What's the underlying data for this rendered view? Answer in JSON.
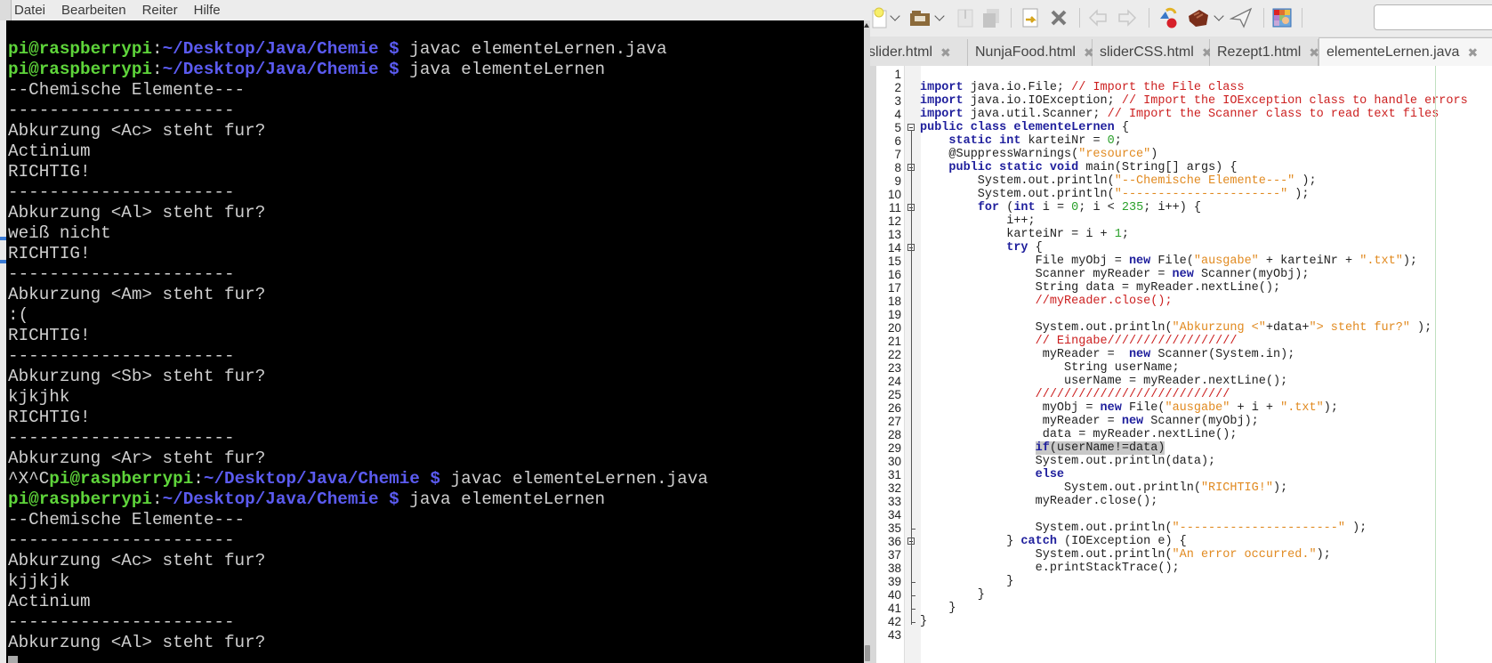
{
  "terminal": {
    "menu": [
      "Datei",
      "Bearbeiten",
      "Reiter",
      "Hilfe"
    ],
    "prompt_user": "pi@raspberrypi",
    "prompt_path": "~/Desktop/Java/Chemie $",
    "lines": [
      {
        "kind": "prompt",
        "prefix": "",
        "cmd": " javac elementeLernen.java"
      },
      {
        "kind": "prompt",
        "prefix": "",
        "cmd": " java elementeLernen"
      },
      {
        "kind": "text",
        "text": "--Chemische Elemente---"
      },
      {
        "kind": "text",
        "text": "----------------------"
      },
      {
        "kind": "text",
        "text": "Abkurzung <Ac> steht fur?"
      },
      {
        "kind": "text",
        "text": "Actinium"
      },
      {
        "kind": "text",
        "text": "RICHTIG!"
      },
      {
        "kind": "text",
        "text": "----------------------"
      },
      {
        "kind": "text",
        "text": "Abkurzung <Al> steht fur?"
      },
      {
        "kind": "text",
        "text": "weiß nicht"
      },
      {
        "kind": "text",
        "text": "RICHTIG!"
      },
      {
        "kind": "text",
        "text": "----------------------"
      },
      {
        "kind": "text",
        "text": "Abkurzung <Am> steht fur?"
      },
      {
        "kind": "text",
        "text": ":("
      },
      {
        "kind": "text",
        "text": "RICHTIG!"
      },
      {
        "kind": "text",
        "text": "----------------------"
      },
      {
        "kind": "text",
        "text": "Abkurzung <Sb> steht fur?"
      },
      {
        "kind": "text",
        "text": "kjkjhk"
      },
      {
        "kind": "text",
        "text": "RICHTIG!"
      },
      {
        "kind": "text",
        "text": "----------------------"
      },
      {
        "kind": "text",
        "text": "Abkurzung <Ar> steht fur?"
      },
      {
        "kind": "prompt",
        "prefix": "^X^C",
        "cmd": " javac elementeLernen.java"
      },
      {
        "kind": "prompt",
        "prefix": "",
        "cmd": " java elementeLernen"
      },
      {
        "kind": "text",
        "text": "--Chemische Elemente---"
      },
      {
        "kind": "text",
        "text": "----------------------"
      },
      {
        "kind": "text",
        "text": "Abkurzung <Ac> steht fur?"
      },
      {
        "kind": "text",
        "text": "kjjkjk"
      },
      {
        "kind": "text",
        "text": "Actinium"
      },
      {
        "kind": "text",
        "text": "----------------------"
      },
      {
        "kind": "text",
        "text": "Abkurzung <Al> steht fur?"
      }
    ],
    "colors": {
      "user": "#5ed43a",
      "path": "#5b5bf0",
      "text": "#cfcfcf",
      "background": "#000000"
    }
  },
  "editor": {
    "toolbar": [
      {
        "name": "new-file-icon",
        "glyph": "🗋",
        "label": "New"
      },
      {
        "name": "open-file-icon",
        "glyph": "🗀",
        "label": "Open"
      },
      {
        "name": "save-icon",
        "glyph": "⤓",
        "label": "Save"
      },
      {
        "name": "save-all-icon",
        "glyph": "⧉",
        "label": "Save all"
      },
      {
        "name": "reload-icon",
        "glyph": "↺",
        "label": "Reload"
      },
      {
        "name": "close-file-icon",
        "glyph": "✖",
        "label": "Close"
      },
      {
        "name": "back-icon",
        "glyph": "⇦",
        "label": "Back"
      },
      {
        "name": "forward-icon",
        "glyph": "⇨",
        "label": "Forward"
      },
      {
        "name": "compile-icon",
        "glyph": "◆",
        "label": "Compile"
      },
      {
        "name": "build-icon",
        "glyph": "▰",
        "label": "Build"
      },
      {
        "name": "execute-icon",
        "glyph": "➢",
        "label": "Execute"
      },
      {
        "name": "color-chooser-icon",
        "glyph": "▦",
        "label": "Color chooser"
      }
    ],
    "search": {
      "value": "",
      "placeholder": ""
    },
    "tabs": [
      {
        "label": "slider.html",
        "active": false
      },
      {
        "label": "NunjaFood.html",
        "active": false
      },
      {
        "label": "sliderCSS.html",
        "active": false
      },
      {
        "label": "Rezept1.html",
        "active": false
      },
      {
        "label": "elementeLernen.java",
        "active": true
      }
    ],
    "tab_close_glyph": "✖",
    "highlighted_line": 29,
    "code": [
      "",
      "import java.io.File; // Import the File class",
      "import java.io.IOException; // Import the IOException class to handle errors",
      "import java.util.Scanner; // Import the Scanner class to read text files",
      "public class elementeLernen {",
      "    static int karteiNr = 0;",
      "    @SuppressWarnings(\"resource\")",
      "    public static void main(String[] args) {",
      "        System.out.println(\"--Chemische Elemente---\" );",
      "        System.out.println(\"----------------------\" );",
      "        for (int i = 0; i < 235; i++) {",
      "            i++;",
      "            karteiNr = i + 1;",
      "            try {",
      "                File myObj = new File(\"ausgabe\" + karteiNr + \".txt\");",
      "                Scanner myReader = new Scanner(myObj);",
      "                String data = myReader.nextLine();",
      "                //myReader.close();",
      "",
      "                System.out.println(\"Abkurzung <\"+data+\"> steht fur?\" );",
      "                // Eingabe//////////////////",
      "                 myReader =  new Scanner(System.in);",
      "                    String userName;",
      "                    userName = myReader.nextLine();",
      "                ///////////////////////////",
      "                 myObj = new File(\"ausgabe\" + i + \".txt\");",
      "                 myReader = new Scanner(myObj);",
      "                 data = myReader.nextLine();",
      "                if(userName!=data)",
      "                System.out.println(data);",
      "                else",
      "                    System.out.println(\"RICHTIG!\");",
      "                myReader.close();",
      "",
      "                System.out.println(\"----------------------\" );",
      "            } catch (IOException e) {",
      "                System.out.println(\"An error occurred.\");",
      "                e.printStackTrace();",
      "            }",
      "        }",
      "    }",
      "}",
      ""
    ],
    "fold_lines": [
      5,
      8,
      11,
      14,
      36
    ],
    "colors": {
      "keyword": "#1e1e9c",
      "comment": "#cc1f1f",
      "string": "#e18a20",
      "number": "#2aa02a"
    }
  }
}
